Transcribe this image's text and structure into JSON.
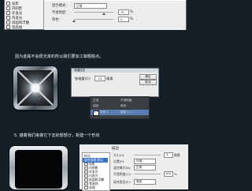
{
  "top_panel": {
    "left_items": [
      "投影",
      "内阴影",
      "外发光",
      "内发光",
      "斜面和浮雕",
      "等高线",
      "纹理"
    ],
    "rows": [
      {
        "label": "混合模式:",
        "value": "正常"
      },
      {
        "label": "不透明度:",
        "value": "75",
        "unit": "%"
      },
      {
        "label": "杂色:",
        "value": "0",
        "unit": "%"
      }
    ]
  },
  "caption_1": "因为金属不会很光滑的所以我们要加工做粗糙点。",
  "mid_dialog": {
    "title": "收缩选区",
    "field_label": "收缩量(C):",
    "field_value": "15",
    "unit": "像素",
    "ok_label": "确定",
    "cancel_label": "取消"
  },
  "layers_panel": {
    "rows": [
      {
        "label": "正常",
        "extra": "不透明度:"
      },
      {
        "label": "锁定:",
        "extra": "填充:"
      },
      {
        "label": "形状 1",
        "extra": "图层 1 ..."
      }
    ]
  },
  "caption_2": "5. 描着我们来做它下去的部部分，新建一个形状",
  "style_dialog": {
    "section": "描边",
    "list": [
      "样式",
      "混合选项:默认",
      "投影",
      "内阴影",
      "外发光",
      "内发光",
      "斜面和浮雕",
      "等高线",
      "纹理",
      "光泽"
    ],
    "selected_index": 1,
    "rows": [
      {
        "label": "大小(S):",
        "value": "3",
        "unit": "像素"
      },
      {
        "label": "位置(P):",
        "value": "外部"
      },
      {
        "label": "混合模式(B):",
        "value": "正常"
      },
      {
        "label": "不透明度(O):",
        "value": "100",
        "unit": "%"
      },
      {
        "label": "填充类型(F):",
        "value": "渐变"
      }
    ]
  },
  "colors": {
    "background": "#161f28",
    "caption": "#eef2f5",
    "metal_light": "#d0d6db",
    "metal_dark": "#4b545d"
  }
}
